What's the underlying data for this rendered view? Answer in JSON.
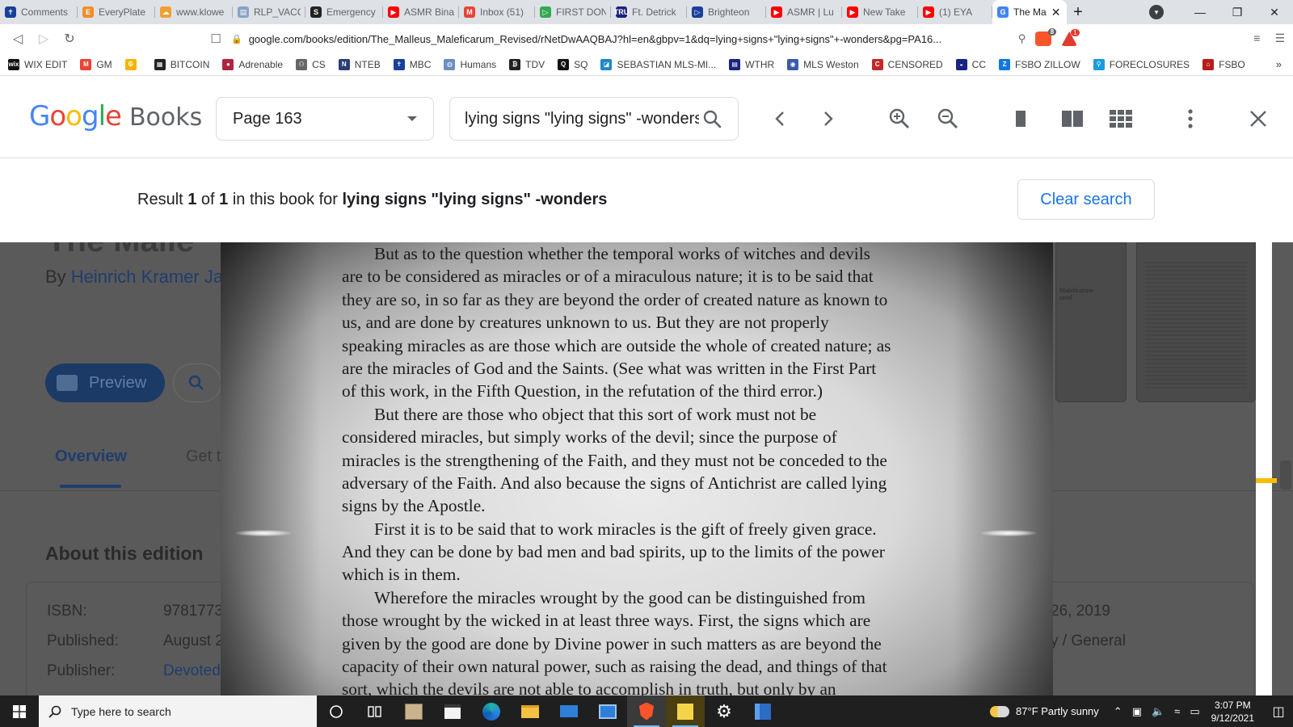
{
  "browser": {
    "tabs": [
      {
        "label": "Comments",
        "color": "#1a3f9c",
        "glyph": "✝"
      },
      {
        "label": "EveryPlate",
        "color": "#f28c28",
        "glyph": "E"
      },
      {
        "label": "www.klowe",
        "color": "#f0a030",
        "glyph": "☁"
      },
      {
        "label": "RLP_VACC",
        "color": "#8aa1c7",
        "glyph": "▤"
      },
      {
        "label": "Emergency",
        "color": "#222222",
        "glyph": "S"
      },
      {
        "label": "ASMR Bina",
        "color": "#ff0000",
        "glyph": "▶"
      },
      {
        "label": "Inbox (51)",
        "color": "#ea4335",
        "glyph": "M"
      },
      {
        "label": "FIRST DON",
        "color": "#34a853",
        "glyph": "▷"
      },
      {
        "label": "Ft. Detrick",
        "color": "#1a237e",
        "glyph": "TRU"
      },
      {
        "label": "Brighteon",
        "color": "#1a3f9c",
        "glyph": "▷"
      },
      {
        "label": "ASMR | Lu",
        "color": "#ff0000",
        "glyph": "▶"
      },
      {
        "label": "New Take",
        "color": "#ff0000",
        "glyph": "▶"
      },
      {
        "label": "(1) EYA",
        "color": "#ff0000",
        "glyph": "▶"
      },
      {
        "label": "The Ma",
        "color": "#4285f4",
        "glyph": "G",
        "active": true
      }
    ],
    "url": "google.com/books/edition/The_Malleus_Maleficarum_Revised/rNetDwAAQBAJ?hl=en&gbpv=1&dq=lying+signs+\"lying+signs\"+-wonders&pg=PA16...",
    "bookmarks": [
      {
        "label": "WIX EDIT",
        "color": "#111111",
        "glyph": "wix"
      },
      {
        "label": "GM",
        "color": "#ea4335",
        "glyph": "M"
      },
      {
        "label": "",
        "color": "#f5b400",
        "glyph": "₲"
      },
      {
        "label": "BITCOIN",
        "color": "#222222",
        "glyph": "▦"
      },
      {
        "label": "Adrenable",
        "color": "#b0243c",
        "glyph": "●"
      },
      {
        "label": "CS",
        "color": "#666666",
        "glyph": "⚇"
      },
      {
        "label": "NTEB",
        "color": "#2d3e75",
        "glyph": "N"
      },
      {
        "label": "MBC",
        "color": "#1a3f9c",
        "glyph": "✝"
      },
      {
        "label": "Humans",
        "color": "#6a8ec2",
        "glyph": "◍"
      },
      {
        "label": "TDV",
        "color": "#222222",
        "glyph": "₿"
      },
      {
        "label": "SQ",
        "color": "#111111",
        "glyph": "Q"
      },
      {
        "label": "SEBASTIAN MLS-MI...",
        "color": "#1e88c8",
        "glyph": "◪"
      },
      {
        "label": "WTHR",
        "color": "#1a237e",
        "glyph": "▤"
      },
      {
        "label": "MLS Weston",
        "color": "#3a5ba8",
        "glyph": "◉"
      },
      {
        "label": "CENSORED",
        "color": "#c62828",
        "glyph": "C"
      },
      {
        "label": "CC",
        "color": "#1a237e",
        "glyph": "◒"
      },
      {
        "label": "FSBO ZILLOW",
        "color": "#1277e1",
        "glyph": "Z"
      },
      {
        "label": "FORECLOSURES",
        "color": "#1a9be0",
        "glyph": "⚲"
      },
      {
        "label": "FSBO",
        "color": "#b71c1c",
        "glyph": "⌂"
      }
    ],
    "bookmarks_more": "»",
    "ext_badge_1": "8",
    "ext_badge_2": "1"
  },
  "books_header": {
    "logo_word": "Google",
    "logo_books": "Books",
    "page_label": "Page 163",
    "search_value": "lying signs \"lying signs\" -wonders"
  },
  "result_bar": {
    "prefix": "Result ",
    "current": "1",
    "of": " of ",
    "total": "1",
    "mid": " in this book for ",
    "query": "lying signs \"lying signs\" -wonders",
    "clear_label": "Clear search"
  },
  "background_page": {
    "title": "The Malle",
    "by": "By ",
    "author": "Heinrich Kramer Ja",
    "preview_label": "Preview",
    "tab_overview": "Overview",
    "tab_get": "Get t",
    "about_heading": "About this edition",
    "fields": [
      {
        "label": "ISBN:",
        "value": "9781773",
        "link": false
      },
      {
        "label": "Published:",
        "value": "August 2",
        "link": false
      },
      {
        "label": "Publisher:",
        "value": "Devoted",
        "link": true
      }
    ],
    "right_date": "26, 2019",
    "right_subject": "y / General",
    "thumb_text_1": "Maleficarum",
    "thumb_text_2": "ravel"
  },
  "scan_page": {
    "lines": [
      {
        "text": "But as to the question whether the temporal works of witches and devils",
        "indent": true
      },
      {
        "text": "are to be considered as miracles or of a miraculous nature; it is to be said that",
        "indent": false
      },
      {
        "text": "they are so, in so far as they are beyond the order of created nature as known to",
        "indent": false
      },
      {
        "text": "us, and are done by creatures unknown to us. But they are not properly",
        "indent": false
      },
      {
        "text": "speaking miracles as are those which are outside the whole of created nature; as",
        "indent": false
      },
      {
        "text": "are the miracles of God and the Saints. (See what was written in the First Part",
        "indent": false
      },
      {
        "text": "of this work, in the Fifth Question, in the refutation of the third error.)",
        "indent": false
      },
      {
        "text": "But there are those who object that this sort of work must not be",
        "indent": true
      },
      {
        "text": "considered miracles, but simply works of the devil; since the purpose of",
        "indent": false
      },
      {
        "text": "miracles is the strengthening of the Faith, and they must not be conceded to the",
        "indent": false
      },
      {
        "text": "adversary of the Faith. And also because the signs of Antichrist are called lying",
        "indent": false
      },
      {
        "text": "signs by the Apostle.",
        "indent": false
      },
      {
        "text": "First it is to be said that to work miracles is the gift of freely given grace.",
        "indent": true
      },
      {
        "text": "And they can be done by bad men and bad spirits, up to the limits of the power",
        "indent": false
      },
      {
        "text": "which is in them.",
        "indent": false
      },
      {
        "text": "Wherefore the miracles wrought by the good can be distinguished from",
        "indent": true
      },
      {
        "text": "those wrought by the wicked in at least three ways. First, the signs which are",
        "indent": false
      },
      {
        "text": "given by the good are done by Divine power in such matters as are beyond the",
        "indent": false
      },
      {
        "text": "capacity of their own natural power, such as raising the dead, and things of that",
        "indent": false
      },
      {
        "text": "sort, which the devils are not able to accomplish in truth, but only by an",
        "indent": false
      }
    ]
  },
  "taskbar": {
    "search_placeholder": "Type here to search",
    "weather": "87°F  Partly sunny",
    "time": "3:07 PM",
    "date": "9/12/2021"
  }
}
